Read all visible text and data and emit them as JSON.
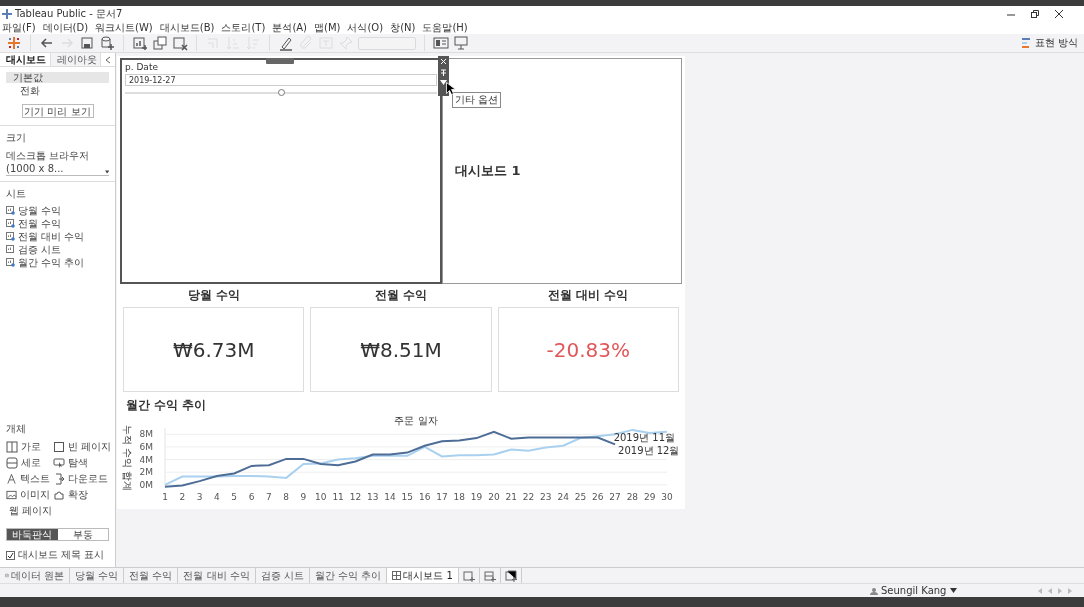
{
  "window": {
    "title": "Tableau Public - 문서7"
  },
  "menu": [
    "파일(F)",
    "데이터(D)",
    "워크시트(W)",
    "대시보드(B)",
    "스토리(T)",
    "분석(A)",
    "맵(M)",
    "서식(O)",
    "창(N)",
    "도움말(H)"
  ],
  "toolbar": {
    "buttons": [
      {
        "kind": "logo",
        "disabled": false
      },
      {
        "kind": "back",
        "disabled": false
      },
      {
        "kind": "forward",
        "disabled": true
      },
      {
        "kind": "save",
        "disabled": false
      },
      {
        "kind": "datasource",
        "disabled": false
      },
      {
        "kind": "newsheet",
        "disabled": false
      },
      {
        "kind": "duplicate",
        "disabled": false
      },
      {
        "kind": "clear",
        "disabled": false
      },
      {
        "kind": "swap",
        "disabled": true
      },
      {
        "kind": "sortasc",
        "disabled": true
      },
      {
        "kind": "sortdesc",
        "disabled": true
      },
      {
        "kind": "highlight",
        "disabled": false
      },
      {
        "kind": "clip",
        "disabled": true
      },
      {
        "kind": "label",
        "disabled": true
      },
      {
        "kind": "pin",
        "disabled": true
      },
      {
        "kind": "dropdown",
        "disabled": true
      },
      {
        "kind": "cards",
        "disabled": false
      },
      {
        "kind": "present",
        "disabled": false
      }
    ],
    "show_me": "표현 방식"
  },
  "sidebar": {
    "tabs": [
      {
        "label": "대시보드",
        "selected": true
      },
      {
        "label": "레이아웃",
        "selected": false
      }
    ],
    "devices": [
      {
        "label": "기본값",
        "selected": true
      },
      {
        "label": "전화",
        "selected": false
      }
    ],
    "preview_button": "기기 미리 보기",
    "size_heading": "크기",
    "size_value": "데스크톱 브라우저(1000 x 8...",
    "sheets_heading": "시트",
    "sheets": [
      {
        "label": "당월 수익",
        "used": true
      },
      {
        "label": "전월 수익",
        "used": true
      },
      {
        "label": "전월 대비 수익",
        "used": true
      },
      {
        "label": "검증 시트",
        "used": false
      },
      {
        "label": "월간 수익 추이",
        "used": true
      }
    ],
    "objects_heading": "개체",
    "objects": [
      {
        "kind": "horizontal",
        "label": "가로"
      },
      {
        "kind": "blank",
        "label": "빈 페이지"
      },
      {
        "kind": "vertical",
        "label": "세로"
      },
      {
        "kind": "navigation",
        "label": "탐색"
      },
      {
        "kind": "text",
        "label": "텍스트"
      },
      {
        "kind": "download",
        "label": "다운로드"
      },
      {
        "kind": "image",
        "label": "이미지"
      },
      {
        "kind": "extension",
        "label": "확장"
      },
      {
        "kind": "web",
        "label": "웹 페이지"
      }
    ],
    "layout_modes": [
      {
        "label": "바둑판식",
        "selected": true
      },
      {
        "label": "부동",
        "selected": false
      }
    ],
    "show_title": {
      "label": "대시보드 제목 표시",
      "checked": true
    }
  },
  "dashboard": {
    "filter": {
      "title": "p. Date",
      "value": "2019-12-27",
      "level": 0.5,
      "selected": true,
      "tooltip": "기타 옵션"
    },
    "title": "대시보드 1",
    "kpis": [
      {
        "title": "당월 수익",
        "value": "₩6.73M",
        "color": "#333333"
      },
      {
        "title": "전월 수익",
        "value": "₩8.51M",
        "color": "#333333"
      },
      {
        "title": "전월 대비 수익",
        "value": "-20.83%",
        "color": "#e15759"
      }
    ],
    "trend": {
      "title": "월간 수익 추이",
      "chart_data": {
        "type": "line",
        "title": "주문 일자",
        "ylabel": "누적 수익 합계",
        "x": [
          1,
          2,
          3,
          4,
          5,
          6,
          7,
          8,
          9,
          10,
          11,
          12,
          13,
          14,
          15,
          16,
          17,
          18,
          19,
          20,
          21,
          22,
          23,
          24,
          25,
          26,
          27,
          28,
          29,
          30
        ],
        "xlim": [
          1,
          30
        ],
        "ylim": [
          -0.5,
          9
        ],
        "grid": true,
        "yticks": [
          {
            "value": 0,
            "label": "0M"
          },
          {
            "value": 2,
            "label": "2M"
          },
          {
            "value": 4,
            "label": "4M"
          },
          {
            "value": 6,
            "label": "6M"
          },
          {
            "value": 8,
            "label": "8M"
          }
        ],
        "xticks": [
          1,
          2,
          3,
          4,
          5,
          6,
          7,
          8,
          9,
          10,
          11,
          12,
          13,
          14,
          15,
          16,
          17,
          18,
          19,
          20,
          21,
          22,
          23,
          24,
          25,
          26,
          27,
          28,
          29,
          30
        ],
        "series": [
          {
            "name": "2019년 11월",
            "color": "#a9d1ef",
            "values": [
              0,
              1.3,
              1.3,
              1.3,
              1.4,
              1.4,
              1.3,
              1.1,
              3.3,
              3.4,
              4.0,
              4.2,
              4.6,
              4.6,
              4.6,
              6.0,
              4.5,
              4.7,
              4.7,
              4.8,
              5.6,
              5.4,
              5.9,
              6.2,
              7.4,
              7.7,
              8.0,
              8.7,
              8.2,
              8.4
            ]
          },
          {
            "name": "2019년 12월",
            "color": "#4e6d96",
            "values": [
              -0.3,
              -0.1,
              0.6,
              1.4,
              1.8,
              3.0,
              3.1,
              4.1,
              4.1,
              3.3,
              3.1,
              3.7,
              4.8,
              4.8,
              5.1,
              6.2,
              6.9,
              7.0,
              7.4,
              8.4,
              7.3,
              7.5,
              7.5,
              7.5,
              7.5,
              7.5,
              6.4,
              null,
              null,
              null
            ]
          }
        ]
      }
    }
  },
  "bottom_tabs": [
    {
      "kind": "datasource",
      "label": "데이터 원본",
      "selected": false
    },
    {
      "kind": "sheet",
      "label": "당월 수익",
      "selected": false
    },
    {
      "kind": "sheet",
      "label": "전월 수익",
      "selected": false
    },
    {
      "kind": "sheet",
      "label": "전월 대비 수익",
      "selected": false
    },
    {
      "kind": "sheet",
      "label": "검증 시트",
      "selected": false
    },
    {
      "kind": "sheet",
      "label": "월간 수익 추이",
      "selected": false
    },
    {
      "kind": "dashboard",
      "label": "대시보드 1",
      "selected": true
    }
  ],
  "status_bar": {
    "user": "Seungil Kang"
  }
}
